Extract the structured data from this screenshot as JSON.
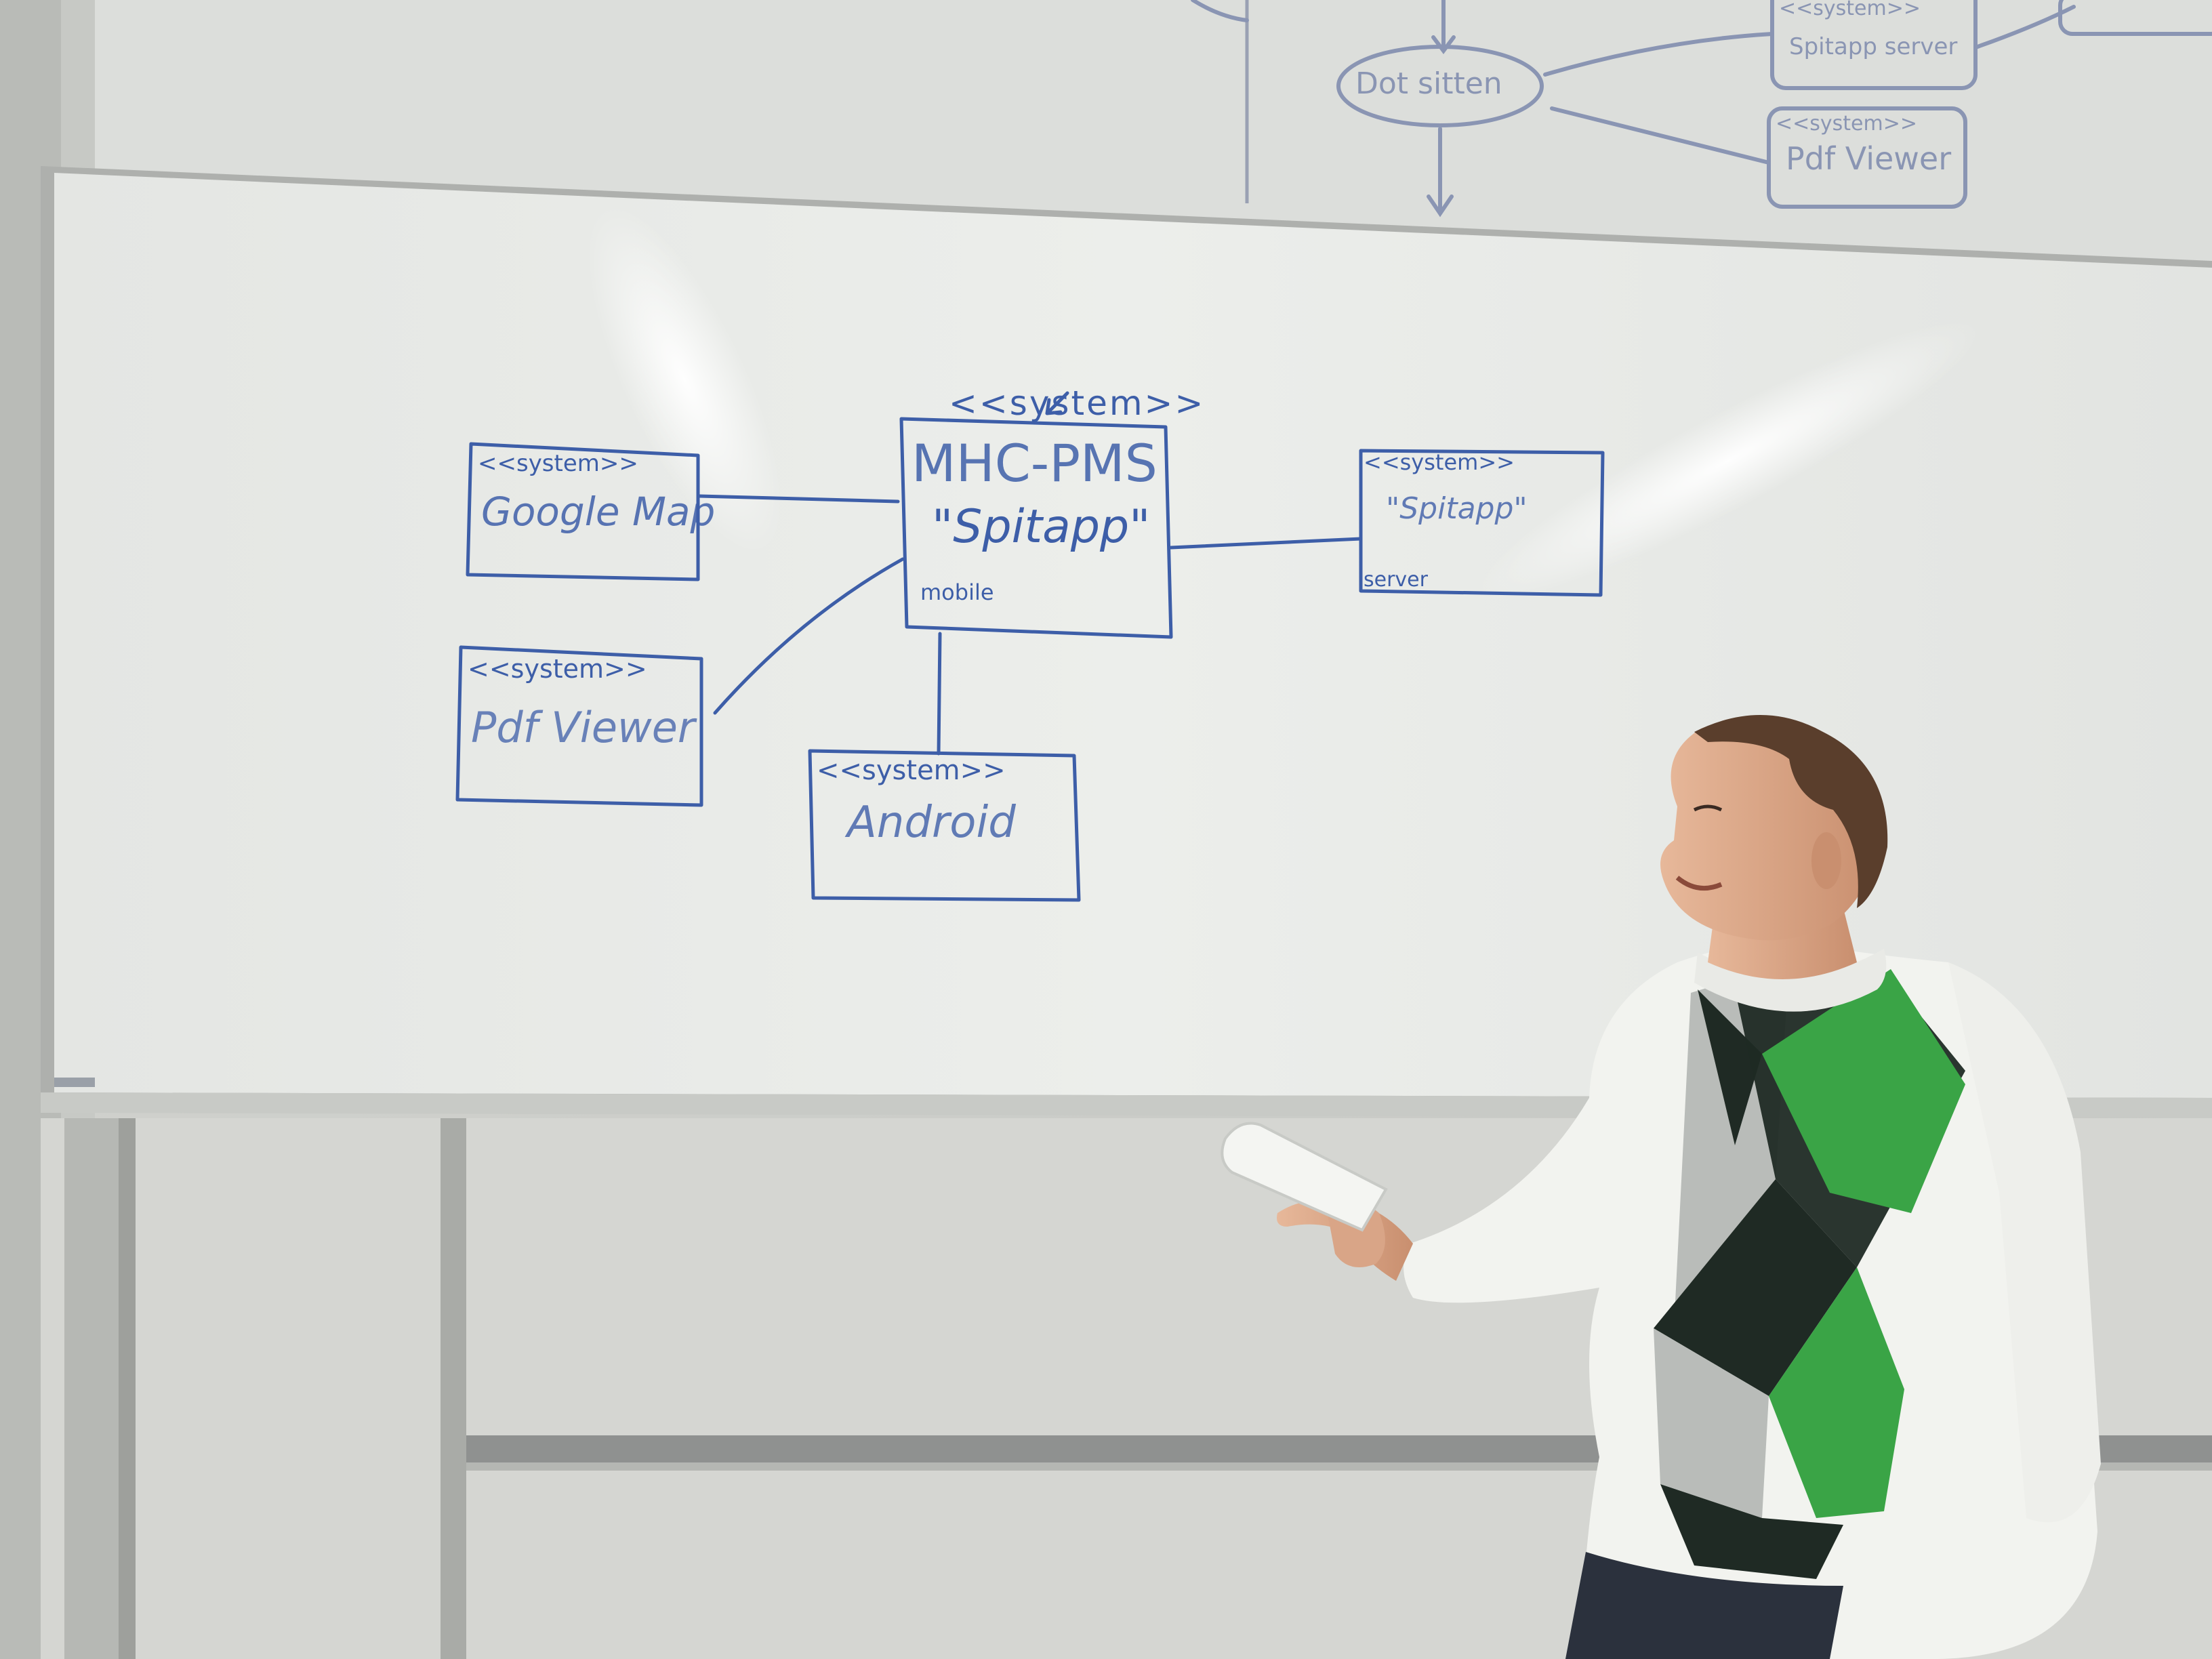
{
  "upper_board": {
    "node_label": "Dot sitten",
    "box_top_stereotype": "<<system>>",
    "box_top_label": "Spitapp server",
    "box_bottom_stereotype": "<<system>>",
    "box_bottom_label": "Pdf Viewer"
  },
  "diagram": {
    "center": {
      "stereotype": "<<system>>",
      "name": "MHC-PMS",
      "alias": "\"Spitapp\"",
      "tag": "mobile"
    },
    "google_maps": {
      "stereotype": "<<system>>",
      "name": "Google Map"
    },
    "pdf_viewer": {
      "stereotype": "<<system>>",
      "name": "Pdf Viewer"
    },
    "android": {
      "stereotype": "<<system>>",
      "name": "Android"
    },
    "server": {
      "stereotype": "<<system>>",
      "name": "\"Spitapp\"",
      "tag": "server"
    }
  },
  "colors": {
    "marker_ink": "#3d5ea8",
    "whiteboard": "#e6e8e5",
    "sweater_green": "#3aa446",
    "sweater_dark": "#1f2a24",
    "sweater_grey": "#b9bcb9"
  }
}
